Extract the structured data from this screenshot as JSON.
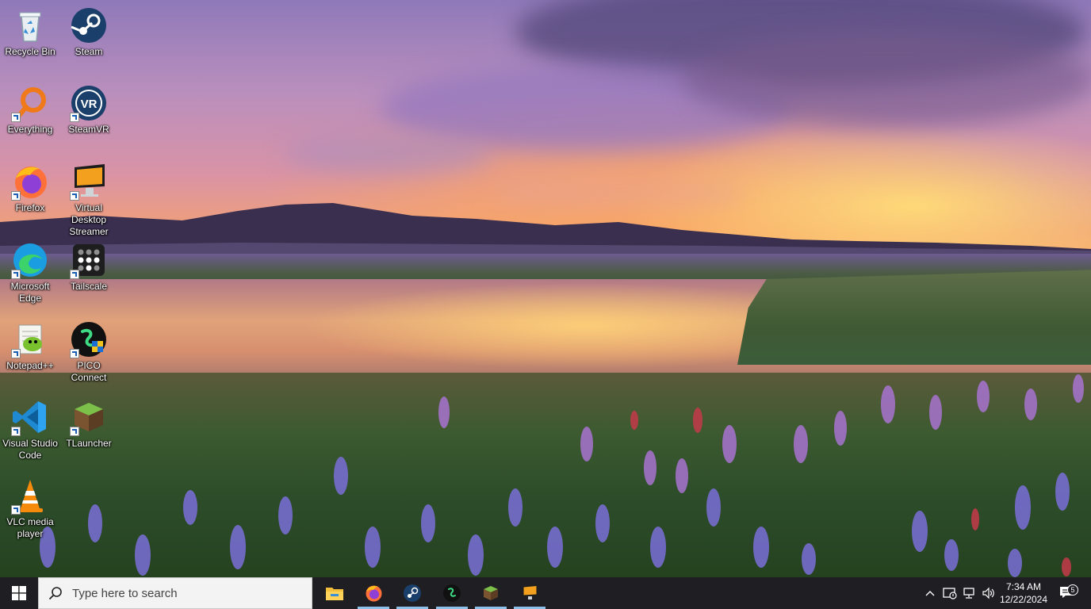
{
  "desktop": {
    "icons": [
      {
        "id": "recycle-bin",
        "label": "Recycle Bin"
      },
      {
        "id": "steam",
        "label": "Steam"
      },
      {
        "id": "everything",
        "label": "Everything"
      },
      {
        "id": "steamvr",
        "label": "SteamVR"
      },
      {
        "id": "firefox",
        "label": "Firefox"
      },
      {
        "id": "virtual-desktop-streamer",
        "label": "Virtual Desktop Streamer"
      },
      {
        "id": "microsoft-edge",
        "label": "Microsoft Edge"
      },
      {
        "id": "tailscale",
        "label": "Tailscale"
      },
      {
        "id": "notepadpp",
        "label": "Notepad++"
      },
      {
        "id": "pico-connect",
        "label": "PICO Connect"
      },
      {
        "id": "vscode",
        "label": "Visual Studio Code"
      },
      {
        "id": "tlauncher",
        "label": "TLauncher"
      },
      {
        "id": "vlc",
        "label": "VLC media player"
      }
    ],
    "steamvr_glyph": "VR"
  },
  "taskbar": {
    "search_placeholder": "Type here to search",
    "pinned": [
      {
        "id": "file-explorer",
        "icon": "folder-icon"
      },
      {
        "id": "firefox",
        "icon": "firefox-icon"
      },
      {
        "id": "steam",
        "icon": "steam-icon"
      },
      {
        "id": "pico-connect",
        "icon": "pico-icon"
      },
      {
        "id": "tlauncher",
        "icon": "tlauncher-icon"
      },
      {
        "id": "virtual-desktop",
        "icon": "monitor-icon"
      }
    ],
    "tray": {
      "time": "7:34 AM",
      "date": "12/22/2024",
      "notification_count": "5"
    }
  },
  "colors": {
    "taskbar_bg": "#1f1f23",
    "running_indicator": "#8fc1e8",
    "windows_blue": "#1a8ce8"
  }
}
